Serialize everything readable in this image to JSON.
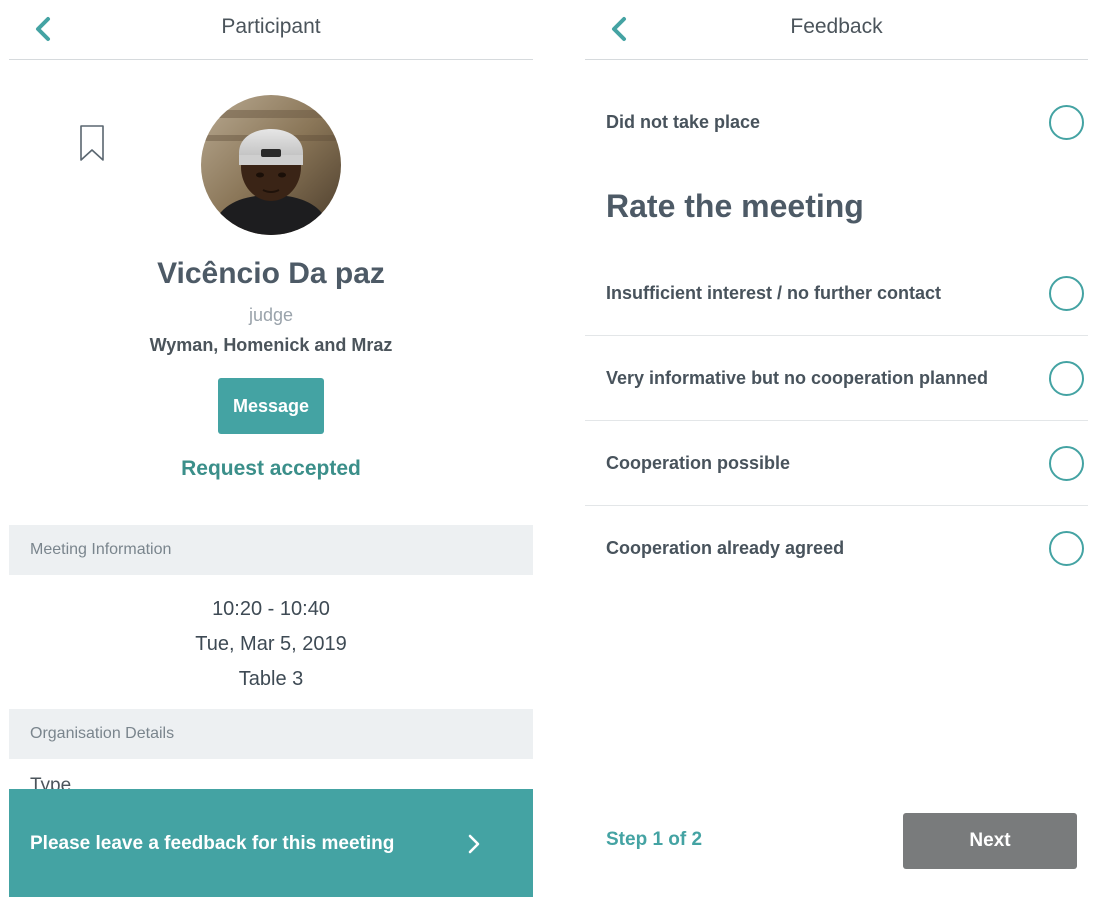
{
  "participant_screen": {
    "header": {
      "title": "Participant",
      "back_icon": "chevron-left-icon"
    },
    "profile": {
      "name": "Vicêncio Da paz",
      "role": "judge",
      "organisation": "Wyman, Homenick and Mraz",
      "message_label": "Message",
      "request_status": "Request accepted",
      "bookmark_icon": "bookmark-icon"
    },
    "meeting_info": {
      "section_title": "Meeting Information",
      "time": "10:20 - 10:40",
      "date": "Tue, Mar 5, 2019",
      "table": "Table 3"
    },
    "org_details": {
      "section_title": "Organisation Details",
      "type_label": "Type"
    },
    "feedback_banner": {
      "text": "Please leave a feedback for this meeting",
      "icon": "chevron-right-icon"
    }
  },
  "feedback_screen": {
    "header": {
      "title": "Feedback",
      "back_icon": "chevron-left-icon"
    },
    "did_not_take_place": "Did not take place",
    "rate_title": "Rate the meeting",
    "options": [
      "Insufficient interest / no further contact",
      "Very informative but no cooperation planned",
      "Cooperation possible",
      "Cooperation already agreed"
    ],
    "step": "Step 1 of 2",
    "next_label": "Next"
  },
  "colors": {
    "accent": "#44a3a3",
    "accent_text": "#3b8f8a",
    "next_button": "#797b7c",
    "section_bg": "#edf0f2"
  }
}
